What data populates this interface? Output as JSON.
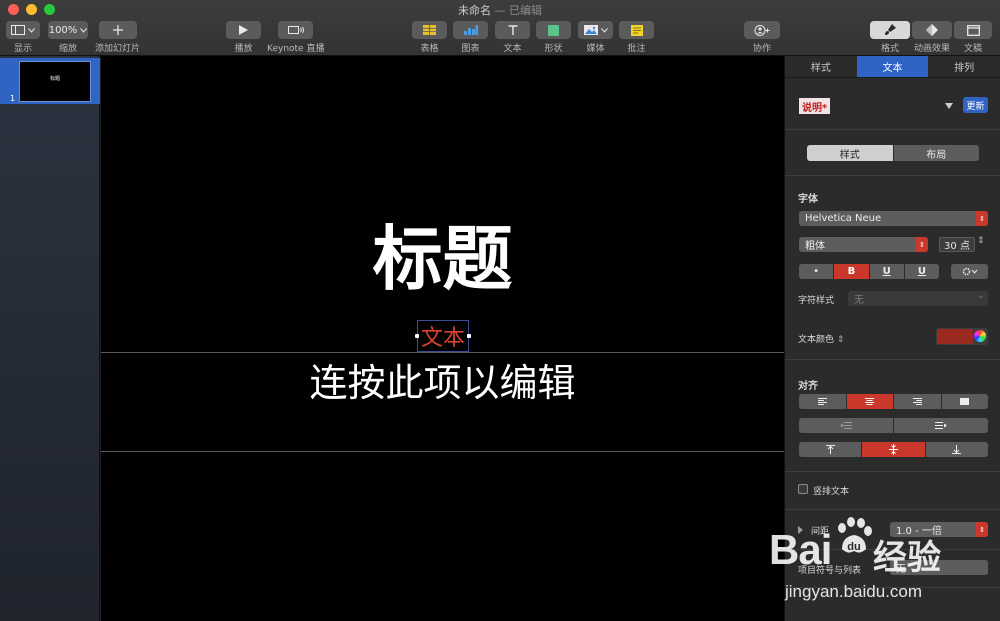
{
  "window": {
    "title": "未命名",
    "edited": "— 已编辑"
  },
  "toolbar": {
    "view_label": "显示",
    "zoom_value": "100%",
    "zoom_label": "缩放",
    "add_slide_label": "添加幻灯片",
    "play_label": "播放",
    "keynote_live_label": "Keynote 直播",
    "table_label": "表格",
    "chart_label": "图表",
    "text_label": "文本",
    "shape_label": "形状",
    "media_label": "媒体",
    "comment_label": "批注",
    "collaborate_label": "协作",
    "format_label": "格式",
    "animate_label": "动画效果",
    "document_label": "文稿"
  },
  "navigator": {
    "slide_number": "1",
    "thumb_title": "标题"
  },
  "slide": {
    "title": "标题",
    "text_placeholder": "文本",
    "body": "连按此项以编辑"
  },
  "inspector": {
    "tabs": [
      "样式",
      "文本",
      "排列"
    ],
    "active_tab": "文本",
    "paragraph_style": "说明*",
    "update_button": "更新",
    "style_layout_tabs": [
      "样式",
      "布局"
    ],
    "font_heading": "字体",
    "font_name": "Helvetica Neue",
    "font_weight": "粗体",
    "font_size": "30 点",
    "format_buttons": [
      "•",
      "B",
      "U",
      "U"
    ],
    "char_style_label": "字符样式",
    "char_style_value": "无",
    "text_color_label": "文本颜色",
    "text_color": "#9a2a1f",
    "alignment_heading": "对齐",
    "vertical_text_label": "竖排文本",
    "spacing_label": "间距",
    "spacing_value": "1.0 - 一倍",
    "bullets_label": "项目符号与列表",
    "bullets_value": "无"
  },
  "watermark": {
    "brand": "Bai",
    "brand_cn": "经验",
    "url": "jingyan.baidu.com"
  }
}
